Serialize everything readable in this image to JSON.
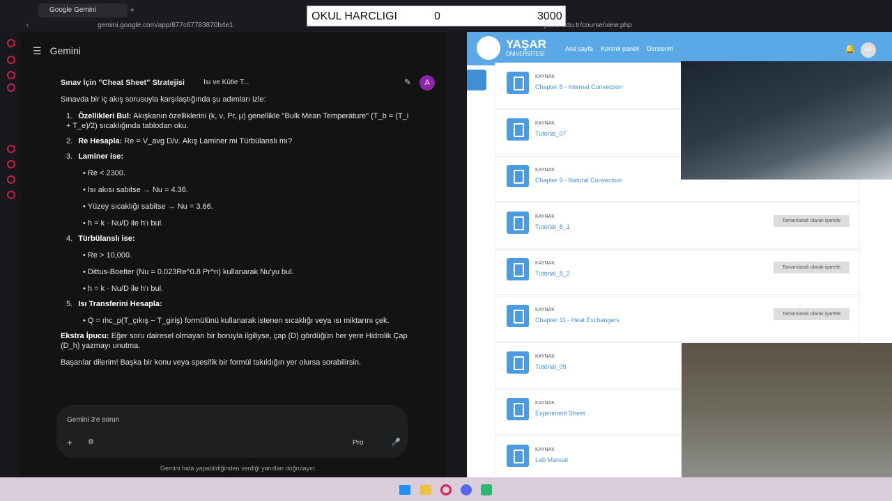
{
  "browser": {
    "tab_title": "Google Gemini",
    "url": "gemini.google.com/app/877c67783870b4e1",
    "right_url": "yasar.edu.tr/course/view.php"
  },
  "overlay": {
    "label": "OKUL HARCLIGI",
    "value": "0",
    "target": "3000"
  },
  "gemini": {
    "app_name": "Gemini",
    "chat_title": "Isı ve Kütle T...",
    "avatar_letter": "A",
    "heading": "Sınav İçin \"Cheat Sheet\" Stratejisi",
    "intro": "Sınavda bir iç akış sorusuyla karşılaştığında şu adımları izle:",
    "steps": [
      {
        "num": "1.",
        "title": "Özellikleri Bul:",
        "text": "Akışkanın özelliklerini (k, ν, Pr, μ) genellikle \"Bulk Mean Temperature\" (T_b = (T_i + T_e)/2) sıcaklığında tablodan oku."
      },
      {
        "num": "2.",
        "title": "Re Hesapla:",
        "text": "Re = V_avg D/ν. Akış Laminer mi Türbülanslı mı?"
      },
      {
        "num": "3.",
        "title": "Laminer ise:",
        "bullets": [
          "Re < 2300.",
          "Isı akısı sabitse → Nu = 4.36.",
          "Yüzey sıcaklığı sabitse → Nu = 3.66.",
          "h = k · Nu/D ile h'ı bul."
        ]
      },
      {
        "num": "4.",
        "title": "Türbülanslı ise:",
        "bullets": [
          "Re > 10,000.",
          "Dittus-Boelter (Nu = 0.023Re^0.8 Pr^n) kullanarak Nu'yu bul.",
          "h = k · Nu/D ile h'ı bul."
        ]
      },
      {
        "num": "5.",
        "title": "Isı Transferini Hesapla:",
        "bullets": [
          "Q̇ = ṁc_p(T_çıkış − T_giriş) formülünü kullanarak istenen sıcaklığı veya ısı miktarını çek."
        ]
      }
    ],
    "tip_title": "Ekstra İpucu:",
    "tip_text": "Eğer soru dairesel olmayan bir boruyla ilgiliyse, çap (D) gördüğün her yere Hidrolik Çap (D_h) yazmayı unutma.",
    "closing": "Başarılar dilerim! Başka bir konu veya spesifik bir formül takıldığın yer olursa sorabilirsin.",
    "input_placeholder": "Gemini 3'e sorun",
    "mode": "Pro",
    "footer": "Gemini hata yapabildiğinden verdiği yanıtları doğrulayın."
  },
  "moodle": {
    "brand": "YAŞAR",
    "brand_sub": "ÜNİVERSİTESİ",
    "nav": [
      "Ana sayfa",
      "Kontrol paneli",
      "Derslerim"
    ],
    "user_initials": "AS",
    "items": [
      {
        "kind": "KAYNAK",
        "name": "Chapter 8 - Internal Convection",
        "done": ""
      },
      {
        "kind": "KAYNAK",
        "name": "Tutorial_07",
        "done": ""
      },
      {
        "kind": "KAYNAK",
        "name": "Chapter 9 - Natural Convection",
        "done": ""
      },
      {
        "kind": "KAYNAK",
        "name": "Tutorial_8_1",
        "done": "Tamamlandı olarak işaretle"
      },
      {
        "kind": "KAYNAK",
        "name": "Tutorial_8_2",
        "done": "Tamamlandı olarak işaretle"
      },
      {
        "kind": "KAYNAK",
        "name": "Chapter 11 - Heat Exchangers",
        "done": "Tamamlandı olarak işaretle"
      },
      {
        "kind": "KAYNAK",
        "name": "Tutorial_09",
        "done": ""
      },
      {
        "kind": "KAYNAK",
        "name": "Experiment Sheet",
        "done": ""
      },
      {
        "kind": "KAYNAK",
        "name": "Lab Manual",
        "done": ""
      }
    ]
  }
}
